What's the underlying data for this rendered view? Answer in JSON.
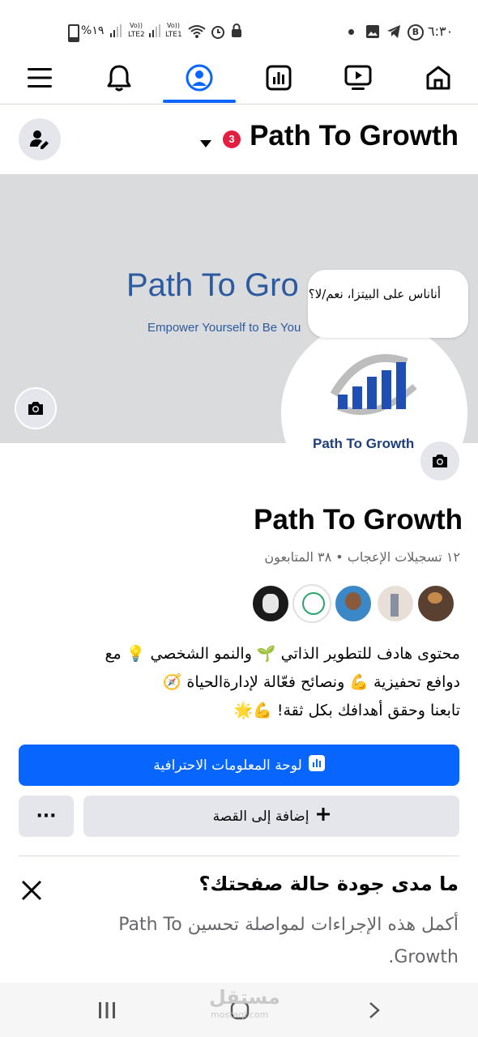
{
  "status_bar": {
    "time": "٦:٣٠",
    "battery": "%١٩",
    "sim2": "LTE2",
    "sim1": "LTE1",
    "volte": "Vo))"
  },
  "tabs": [
    {
      "name": "menu",
      "icon": "menu-icon"
    },
    {
      "name": "notifications",
      "icon": "bell-icon"
    },
    {
      "name": "profile",
      "icon": "profile-icon",
      "active": true
    },
    {
      "name": "insights",
      "icon": "chart-icon"
    },
    {
      "name": "video",
      "icon": "video-icon"
    },
    {
      "name": "home",
      "icon": "home-icon"
    }
  ],
  "header": {
    "page_name": "Path To Growth",
    "notification_count": "3"
  },
  "cover": {
    "title": "Path To Gro",
    "subtitle": "Empower Yourself to Be You",
    "logo_text": "Path To Growth",
    "bubble_note": "أناناس على البيتزا، نعم/لا؟"
  },
  "profile": {
    "name": "Path To Growth",
    "stats": "١٢ تسجيلات الإعجاب • ٣٨ المتابعون",
    "bio_line1": "محتوى هادف للتطوير الذاتي 🌱 والنمو الشخصي 💡 مع",
    "bio_line2": "دوافع تحفيزية 💪 ونصائح فعّالة لإدارةالحياة 🧭",
    "bio_line3": "تابعنا وحقق أهدافك بكل ثقة! 💪🌟"
  },
  "actions": {
    "dashboard_label": "لوحة المعلومات الاحترافية",
    "add_story_label": "إضافة إلى القصة",
    "more_label": "···"
  },
  "quality": {
    "title": "ما مدى جودة حالة صفحتك؟",
    "description": "أكمل هذه الإجراءات لمواصلة تحسين Path To Growth."
  },
  "watermark": {
    "text": "مستقل",
    "sub": "mostaql.com"
  },
  "colors": {
    "accent": "#0866ff",
    "badge": "#e41e3f",
    "cover_bg": "#dadbdd",
    "cover_text": "#2c5aa0"
  }
}
